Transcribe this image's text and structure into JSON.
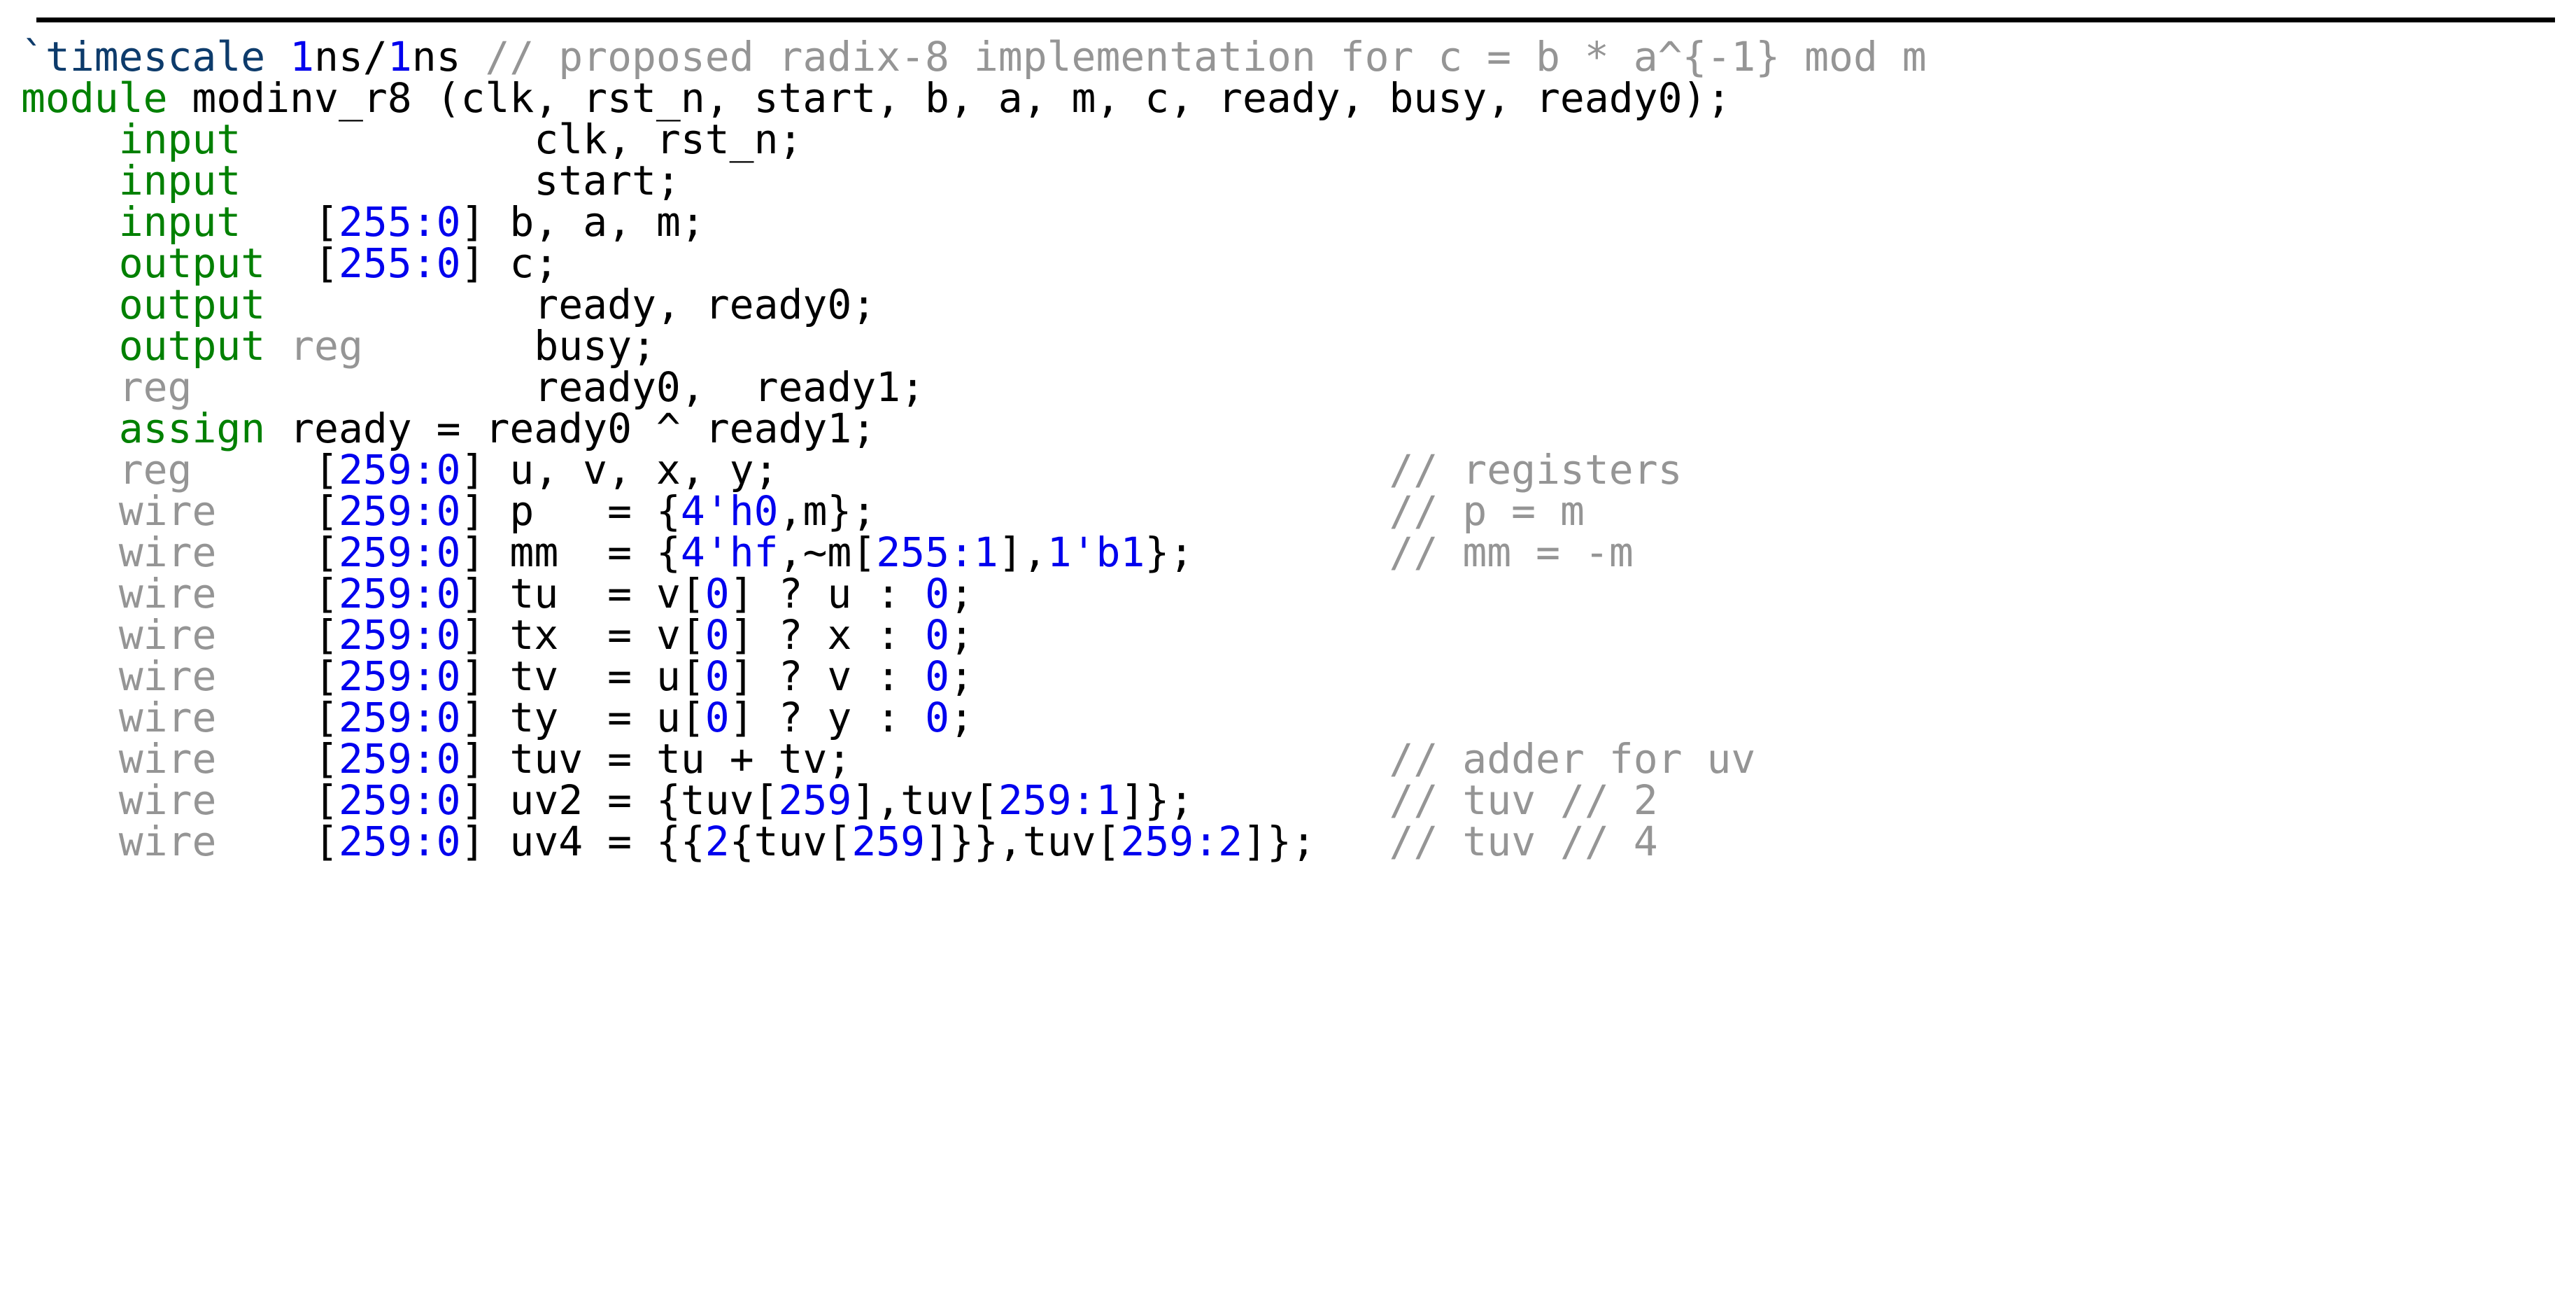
{
  "document": {
    "kind": "verilog-code-listing",
    "language": "Verilog",
    "module_name": "modinv_r8",
    "rule_visible": true
  },
  "colors": {
    "background": "#ffffff",
    "default_text": "#000000",
    "keyword_green": "#008000",
    "directive_navy": "#0d3b6b",
    "number_blue": "#0000ee",
    "comment_gray": "#959595",
    "rule": "#000000"
  },
  "code": {
    "lines": [
      {
        "id": "line-1",
        "text": "`timescale 1ns/1ns // proposed radix-8 implementation for c = b * a^{-1} mod m",
        "tokens": [
          {
            "t": "`timescale",
            "c": "dir"
          },
          {
            "t": " ",
            "c": "pun"
          },
          {
            "t": "1",
            "c": "num"
          },
          {
            "t": "ns/",
            "c": "id"
          },
          {
            "t": "1",
            "c": "num"
          },
          {
            "t": "ns ",
            "c": "id"
          },
          {
            "t": "// proposed radix-8 implementation for c = b * a^{-1} mod m",
            "c": "cmt"
          }
        ]
      },
      {
        "id": "line-2",
        "text": "module modinv_r8 (clk, rst_n, start, b, a, m, c, ready, busy, ready0);",
        "tokens": [
          {
            "t": "module",
            "c": "kw"
          },
          {
            "t": " modinv_r8 (clk, rst_n, start, b, a, m, c, ready, busy, ready0);",
            "c": "id"
          }
        ]
      },
      {
        "id": "line-3",
        "text": "    input            clk, rst_n;",
        "tokens": [
          {
            "t": "    ",
            "c": "pun"
          },
          {
            "t": "input",
            "c": "kw"
          },
          {
            "t": "            clk, rst_n;",
            "c": "id"
          }
        ]
      },
      {
        "id": "line-4",
        "text": "    input            start;",
        "tokens": [
          {
            "t": "    ",
            "c": "pun"
          },
          {
            "t": "input",
            "c": "kw"
          },
          {
            "t": "            start;",
            "c": "id"
          }
        ]
      },
      {
        "id": "line-5",
        "text": "    input   [255:0] b, a, m;",
        "tokens": [
          {
            "t": "    ",
            "c": "pun"
          },
          {
            "t": "input",
            "c": "kw"
          },
          {
            "t": "   [",
            "c": "pun"
          },
          {
            "t": "255:0",
            "c": "num"
          },
          {
            "t": "] b, a, m;",
            "c": "id"
          }
        ]
      },
      {
        "id": "line-6",
        "text": "    output  [255:0] c;",
        "tokens": [
          {
            "t": "    ",
            "c": "pun"
          },
          {
            "t": "output",
            "c": "kw"
          },
          {
            "t": "  [",
            "c": "pun"
          },
          {
            "t": "255:0",
            "c": "num"
          },
          {
            "t": "] c;",
            "c": "id"
          }
        ]
      },
      {
        "id": "line-7",
        "text": "    output           ready, ready0;",
        "tokens": [
          {
            "t": "    ",
            "c": "pun"
          },
          {
            "t": "output",
            "c": "kw"
          },
          {
            "t": "           ready, ready0;",
            "c": "id"
          }
        ]
      },
      {
        "id": "line-8",
        "text": "    output reg       busy;",
        "tokens": [
          {
            "t": "    ",
            "c": "pun"
          },
          {
            "t": "output",
            "c": "kw"
          },
          {
            "t": " ",
            "c": "pun"
          },
          {
            "t": "reg",
            "c": "typ"
          },
          {
            "t": "       busy;",
            "c": "id"
          }
        ]
      },
      {
        "id": "line-9",
        "text": "    reg              ready0,  ready1;",
        "tokens": [
          {
            "t": "    ",
            "c": "pun"
          },
          {
            "t": "reg",
            "c": "typ"
          },
          {
            "t": "              ready0,  ready1;",
            "c": "id"
          }
        ]
      },
      {
        "id": "line-10",
        "text": "    assign ready = ready0 ^ ready1;",
        "tokens": [
          {
            "t": "    ",
            "c": "pun"
          },
          {
            "t": "assign",
            "c": "kw"
          },
          {
            "t": " ready = ready0 ^ ready1;",
            "c": "id"
          }
        ]
      },
      {
        "id": "line-11",
        "text": "    reg     [259:0] u, v, x, y;",
        "comment": "// registers",
        "tokens": [
          {
            "t": "    ",
            "c": "pun"
          },
          {
            "t": "reg",
            "c": "typ"
          },
          {
            "t": "     [",
            "c": "pun"
          },
          {
            "t": "259:0",
            "c": "num"
          },
          {
            "t": "] u, v, x, y;",
            "c": "id"
          }
        ]
      },
      {
        "id": "line-12",
        "text": "    wire    [259:0] p   = {4'h0,m};",
        "comment": "// p = m",
        "tokens": [
          {
            "t": "    ",
            "c": "pun"
          },
          {
            "t": "wire",
            "c": "typ"
          },
          {
            "t": "    [",
            "c": "pun"
          },
          {
            "t": "259:0",
            "c": "num"
          },
          {
            "t": "] p   = {",
            "c": "id"
          },
          {
            "t": "4'h0",
            "c": "num"
          },
          {
            "t": ",m};",
            "c": "id"
          }
        ]
      },
      {
        "id": "line-13",
        "text": "    wire    [259:0] mm  = {4'hf,~m[255:1],1'b1};",
        "comment": "// mm = -m",
        "tokens": [
          {
            "t": "    ",
            "c": "pun"
          },
          {
            "t": "wire",
            "c": "typ"
          },
          {
            "t": "    [",
            "c": "pun"
          },
          {
            "t": "259:0",
            "c": "num"
          },
          {
            "t": "] mm  = {",
            "c": "id"
          },
          {
            "t": "4'hf",
            "c": "num"
          },
          {
            "t": ",~m[",
            "c": "id"
          },
          {
            "t": "255:1",
            "c": "num"
          },
          {
            "t": "],",
            "c": "id"
          },
          {
            "t": "1'b1",
            "c": "num"
          },
          {
            "t": "};",
            "c": "id"
          }
        ]
      },
      {
        "id": "line-14",
        "text": "    wire    [259:0] tu  = v[0] ? u : 0;",
        "comment": "",
        "tokens": [
          {
            "t": "    ",
            "c": "pun"
          },
          {
            "t": "wire",
            "c": "typ"
          },
          {
            "t": "    [",
            "c": "pun"
          },
          {
            "t": "259:0",
            "c": "num"
          },
          {
            "t": "] tu  = v[",
            "c": "id"
          },
          {
            "t": "0",
            "c": "num"
          },
          {
            "t": "] ? u : ",
            "c": "id"
          },
          {
            "t": "0",
            "c": "num"
          },
          {
            "t": ";",
            "c": "id"
          }
        ]
      },
      {
        "id": "line-15",
        "text": "    wire    [259:0] tx  = v[0] ? x : 0;",
        "comment": "",
        "tokens": [
          {
            "t": "    ",
            "c": "pun"
          },
          {
            "t": "wire",
            "c": "typ"
          },
          {
            "t": "    [",
            "c": "pun"
          },
          {
            "t": "259:0",
            "c": "num"
          },
          {
            "t": "] tx  = v[",
            "c": "id"
          },
          {
            "t": "0",
            "c": "num"
          },
          {
            "t": "] ? x : ",
            "c": "id"
          },
          {
            "t": "0",
            "c": "num"
          },
          {
            "t": ";",
            "c": "id"
          }
        ]
      },
      {
        "id": "line-16",
        "text": "    wire    [259:0] tv  = u[0] ? v : 0;",
        "comment": "",
        "tokens": [
          {
            "t": "    ",
            "c": "pun"
          },
          {
            "t": "wire",
            "c": "typ"
          },
          {
            "t": "    [",
            "c": "pun"
          },
          {
            "t": "259:0",
            "c": "num"
          },
          {
            "t": "] tv  = u[",
            "c": "id"
          },
          {
            "t": "0",
            "c": "num"
          },
          {
            "t": "] ? v : ",
            "c": "id"
          },
          {
            "t": "0",
            "c": "num"
          },
          {
            "t": ";",
            "c": "id"
          }
        ]
      },
      {
        "id": "line-17",
        "text": "    wire    [259:0] ty  = u[0] ? y : 0;",
        "comment": "",
        "tokens": [
          {
            "t": "    ",
            "c": "pun"
          },
          {
            "t": "wire",
            "c": "typ"
          },
          {
            "t": "    [",
            "c": "pun"
          },
          {
            "t": "259:0",
            "c": "num"
          },
          {
            "t": "] ty  = u[",
            "c": "id"
          },
          {
            "t": "0",
            "c": "num"
          },
          {
            "t": "] ? y : ",
            "c": "id"
          },
          {
            "t": "0",
            "c": "num"
          },
          {
            "t": ";",
            "c": "id"
          }
        ]
      },
      {
        "id": "line-18",
        "text": "    wire    [259:0] tuv = tu + tv;",
        "comment": "// adder for uv",
        "tokens": [
          {
            "t": "    ",
            "c": "pun"
          },
          {
            "t": "wire",
            "c": "typ"
          },
          {
            "t": "    [",
            "c": "pun"
          },
          {
            "t": "259:0",
            "c": "num"
          },
          {
            "t": "] tuv = tu + tv;",
            "c": "id"
          }
        ]
      },
      {
        "id": "line-19",
        "text": "    wire    [259:0] uv2 = {tuv[259],tuv[259:1]};",
        "comment": "// tuv // 2",
        "tokens": [
          {
            "t": "    ",
            "c": "pun"
          },
          {
            "t": "wire",
            "c": "typ"
          },
          {
            "t": "    [",
            "c": "pun"
          },
          {
            "t": "259:0",
            "c": "num"
          },
          {
            "t": "] uv2 = {tuv[",
            "c": "id"
          },
          {
            "t": "259",
            "c": "num"
          },
          {
            "t": "],tuv[",
            "c": "id"
          },
          {
            "t": "259:1",
            "c": "num"
          },
          {
            "t": "]};",
            "c": "id"
          }
        ]
      },
      {
        "id": "line-20",
        "text": "    wire    [259:0] uv4 = {{2{tuv[259]}},tuv[259:2]};",
        "comment": "// tuv // 4",
        "tokens": [
          {
            "t": "    ",
            "c": "pun"
          },
          {
            "t": "wire",
            "c": "typ"
          },
          {
            "t": "    [",
            "c": "pun"
          },
          {
            "t": "259:0",
            "c": "num"
          },
          {
            "t": "] uv4 = {{",
            "c": "id"
          },
          {
            "t": "2",
            "c": "num"
          },
          {
            "t": "{tuv[",
            "c": "id"
          },
          {
            "t": "259",
            "c": "num"
          },
          {
            "t": "]}},tuv[",
            "c": "id"
          },
          {
            "t": "259:2",
            "c": "num"
          },
          {
            "t": "]};",
            "c": "id"
          }
        ]
      }
    ],
    "comment_column_chars": 56
  }
}
